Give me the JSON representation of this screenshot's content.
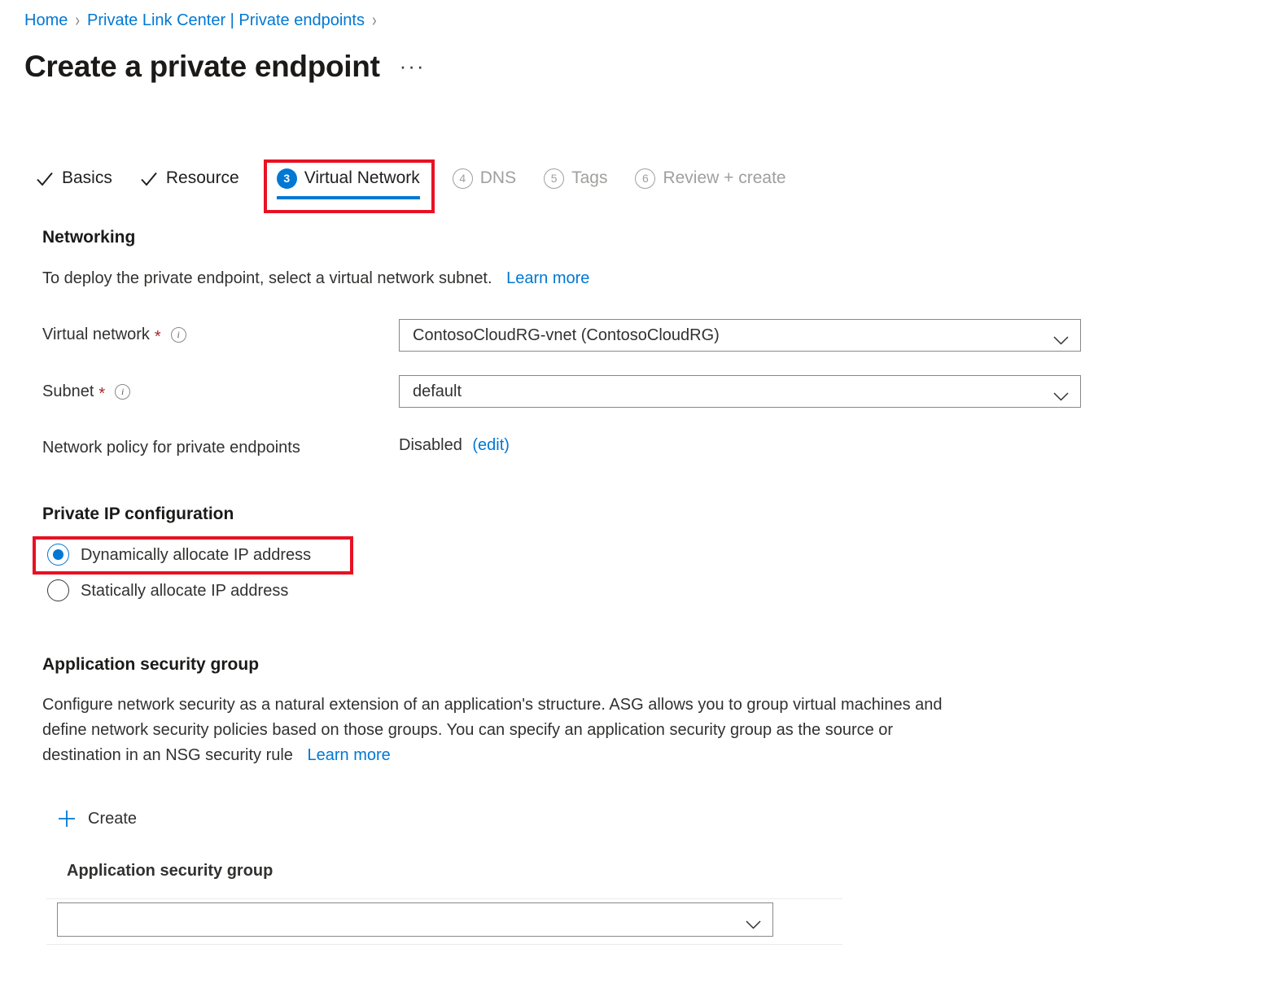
{
  "breadcrumb": {
    "items": [
      {
        "label": "Home"
      },
      {
        "label": "Private Link Center | Private endpoints"
      }
    ],
    "separator": "›"
  },
  "header": {
    "title": "Create a private endpoint",
    "more_label": "···"
  },
  "tabs": [
    {
      "label": "Basics",
      "state": "done",
      "marker": "check"
    },
    {
      "label": "Resource",
      "state": "done",
      "marker": "check"
    },
    {
      "label": "Virtual Network",
      "state": "current",
      "marker": "3"
    },
    {
      "label": "DNS",
      "state": "disabled",
      "marker": "4"
    },
    {
      "label": "Tags",
      "state": "disabled",
      "marker": "5"
    },
    {
      "label": "Review + create",
      "state": "disabled",
      "marker": "6"
    }
  ],
  "networking": {
    "heading": "Networking",
    "description": "To deploy the private endpoint, select a virtual network subnet.",
    "learn_more": "Learn more",
    "virtual_network": {
      "label": "Virtual network",
      "required": "*",
      "info": "i",
      "value": "ContosoCloudRG-vnet (ContosoCloudRG)"
    },
    "subnet": {
      "label": "Subnet",
      "required": "*",
      "info": "i",
      "value": "default"
    },
    "network_policy": {
      "label": "Network policy for private endpoints",
      "value": "Disabled",
      "edit_link": "(edit)"
    }
  },
  "private_ip": {
    "heading": "Private IP configuration",
    "options": [
      {
        "label": "Dynamically allocate IP address",
        "selected": true
      },
      {
        "label": "Statically allocate IP address",
        "selected": false
      }
    ]
  },
  "asg": {
    "heading": "Application security group",
    "description_line1": "Configure network security as a natural extension of an application's structure. ASG allows you to group virtual machines and",
    "description_line2": "define network security policies based on those groups. You can specify an application security group as the source or",
    "description_line3": "destination in an NSG security rule",
    "learn_more": "Learn more",
    "create_label": "Create",
    "column_header": "Application security group",
    "dropdown_value": "",
    "dropdown_placeholder": ""
  },
  "colors": {
    "accent_blue": "#0078d4",
    "link_blue": "#0078d4",
    "annotation_red": "#e81123",
    "required_red": "#a4262c",
    "disabled_grey": "#a19f9d",
    "text": "#323130"
  }
}
